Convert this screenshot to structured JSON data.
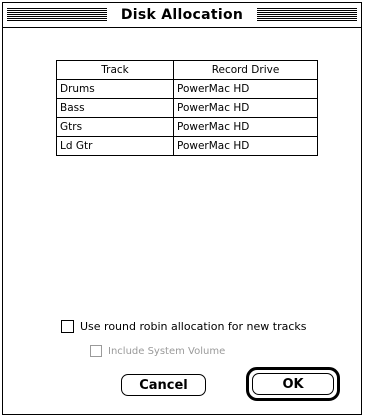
{
  "window": {
    "title": "Disk Allocation"
  },
  "table": {
    "headers": [
      "Track",
      "Record Drive"
    ],
    "rows": [
      [
        "Drums",
        "PowerMac HD"
      ],
      [
        "Bass",
        "PowerMac HD"
      ],
      [
        "Gtrs",
        "PowerMac HD"
      ],
      [
        "Ld Gtr",
        "PowerMac HD"
      ]
    ]
  },
  "options": {
    "round_robin": {
      "label": "Use round robin allocation for new tracks",
      "checked": false
    },
    "include_system": {
      "label": "Include System Volume",
      "checked": false,
      "disabled": true
    }
  },
  "buttons": {
    "cancel": "Cancel",
    "ok": "OK"
  }
}
